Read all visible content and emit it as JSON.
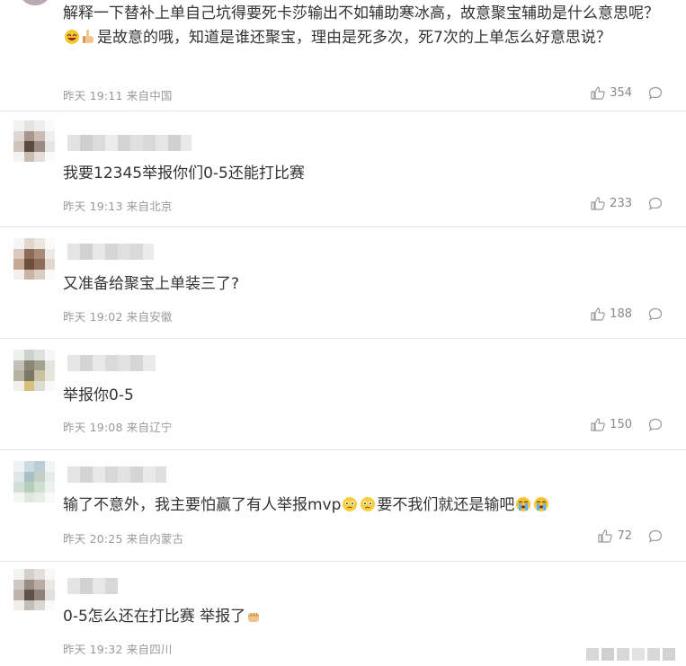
{
  "comments": [
    {
      "text": "解释一下替补上单自己坑得要死卡莎输出不如辅助寒冰高，故意聚宝辅助是什么意思呢？",
      "text2": "是故意的哦，知道是谁还聚宝，理由是死多次，死7次的上单怎么好意思说？",
      "time": "昨天 19:11",
      "location": "来自中国",
      "likes": "354"
    },
    {
      "text": "我要12345举报你们0-5还能打比赛",
      "time": "昨天 19:13",
      "location": "来自北京",
      "likes": "233"
    },
    {
      "text": "又准备给聚宝上单装三了?",
      "time": "昨天 19:02",
      "location": "来自安徽",
      "likes": "188"
    },
    {
      "text": "举报你0-5",
      "time": "昨天 19:08",
      "location": "来自辽宁",
      "likes": "150"
    },
    {
      "text": "输了不意外，我主要怕赢了有人举报mvp",
      "text2": "要不我们就还是输吧",
      "time": "昨天 20:25",
      "location": "来自内蒙古",
      "likes": "72"
    },
    {
      "text": "0-5怎么还在打比赛 举报了",
      "time": "昨天 19:32",
      "location": "来自四川",
      "likes": ""
    }
  ],
  "icons": {
    "like": "thumbs-up-icon",
    "reply": "comment-bubble-icon"
  },
  "colors": {
    "meta": "#999999",
    "text": "#333333",
    "divider": "#e6e6e6"
  }
}
